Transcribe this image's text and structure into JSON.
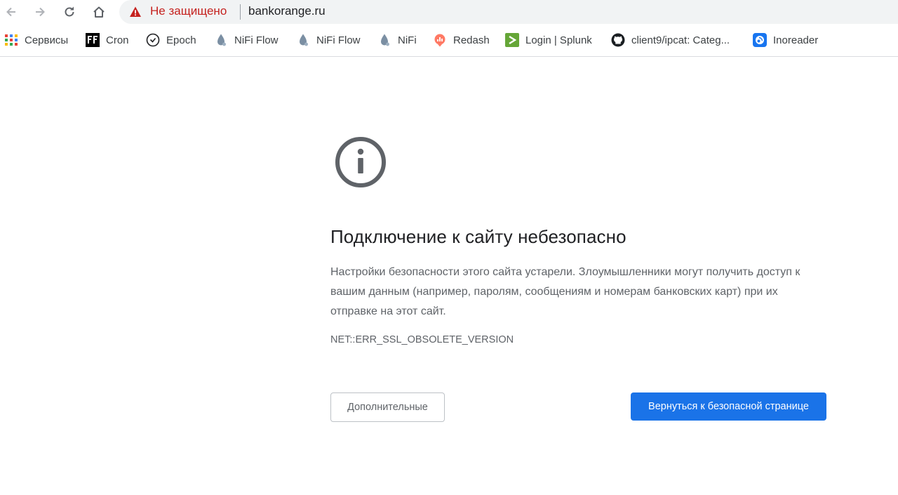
{
  "toolbar": {
    "back_icon": "arrow-left-icon",
    "forward_icon": "arrow-right-icon",
    "reload_icon": "reload-icon",
    "home_icon": "home-icon",
    "security_icon": "warning-triangle-icon",
    "security_label": "Не защищено",
    "url": "bankorange.ru"
  },
  "bookmarks": [
    {
      "label": "Сервисы",
      "icon": "apps-grid-icon"
    },
    {
      "label": "Cron",
      "icon": "ff-logo-icon"
    },
    {
      "label": "Epoch",
      "icon": "clock-icon"
    },
    {
      "label": "NiFi Flow",
      "icon": "drop-icon"
    },
    {
      "label": "NiFi Flow",
      "icon": "drop-icon"
    },
    {
      "label": "NiFi",
      "icon": "drop-icon"
    },
    {
      "label": "Redash",
      "icon": "redash-icon"
    },
    {
      "label": "Login | Splunk",
      "icon": "splunk-icon"
    },
    {
      "label": "client9/ipcat: Categ...",
      "icon": "github-icon"
    },
    {
      "label": "Inoreader",
      "icon": "inoreader-icon"
    }
  ],
  "interstitial": {
    "icon": "info-circle-icon",
    "heading": "Подключение к сайту небезопасно",
    "explanation": "Настройки безопасности этого сайта устарели. Злоумышленники могут получить доступ к вашим данным (например, паролям, сообщениям и номерам банковских карт) при их отправке на этот сайт.",
    "error_code": "NET::ERR_SSL_OBSOLETE_VERSION",
    "details_button": "Дополнительные",
    "primary_button": "Вернуться к безопасной странице"
  },
  "colors": {
    "warning": "#c5221f",
    "primary": "#1a73e8",
    "secondary_text": "#5f6368",
    "omnibox_bg": "#f1f3f4"
  }
}
